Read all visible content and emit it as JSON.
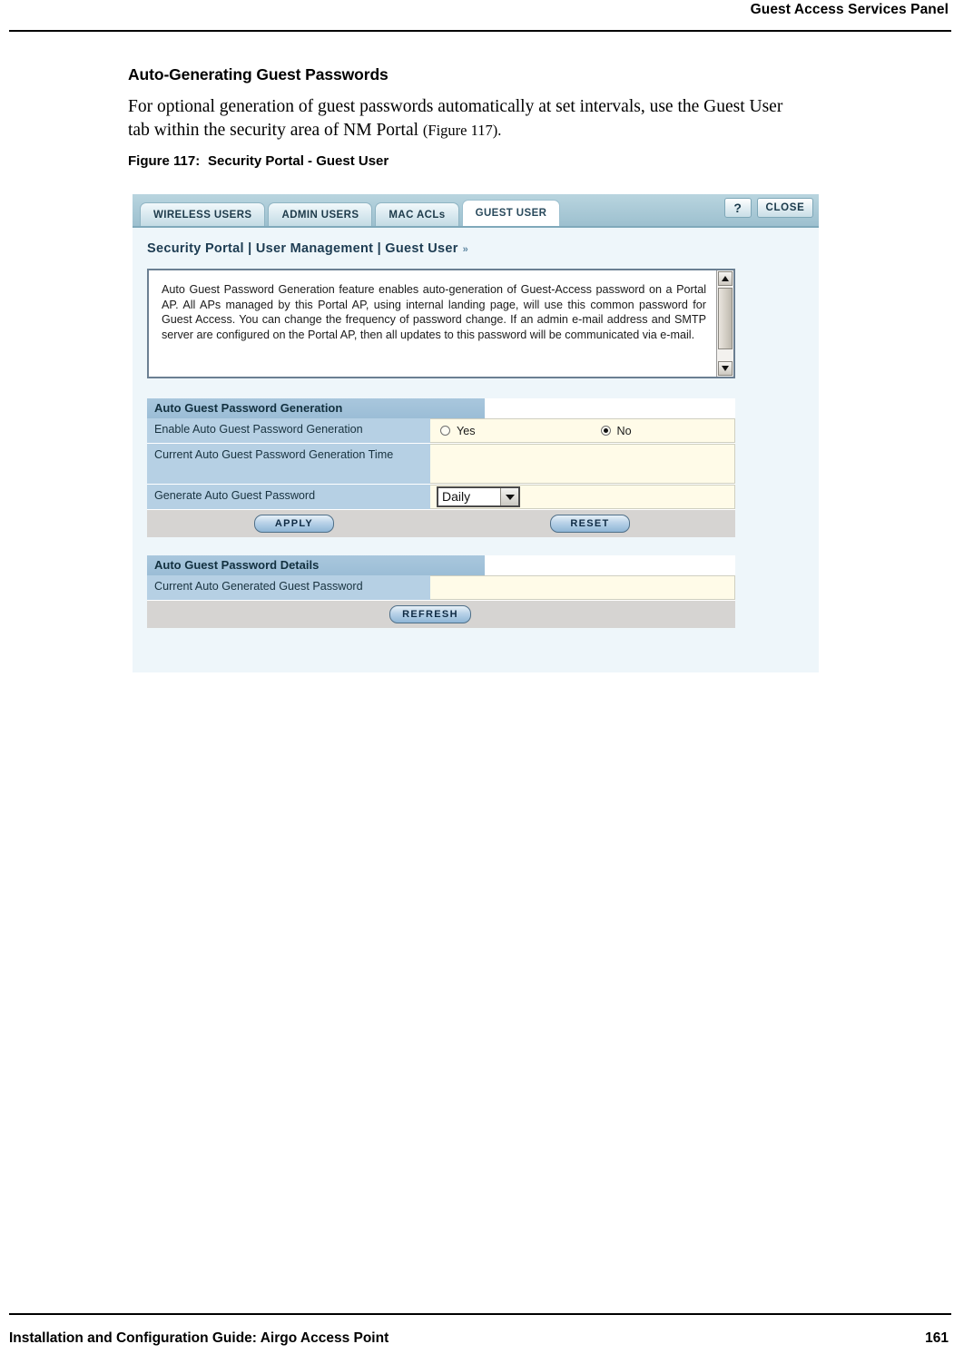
{
  "page": {
    "running_head": "Guest Access Services Panel",
    "footer_left": "Installation and Configuration Guide: Airgo Access Point",
    "footer_page_number": "161"
  },
  "content": {
    "section_heading": "Auto-Generating Guest Passwords",
    "paragraph_main": "For optional generation of guest passwords automatically at set intervals, use the Guest User tab within the security area of NM Portal ",
    "paragraph_figref": "(Figure 117).",
    "figure_caption_number": "Figure 117:",
    "figure_caption_title": "Security Portal - Guest User"
  },
  "screenshot": {
    "tabs": [
      {
        "label": "WIRELESS USERS",
        "active": false
      },
      {
        "label": "ADMIN USERS",
        "active": false
      },
      {
        "label": "MAC ACLs",
        "active": false
      },
      {
        "label": "GUEST USER",
        "active": true
      }
    ],
    "help_button_label": "?",
    "close_button_label": "CLOSE",
    "breadcrumb": "Security Portal | User Management | Guest User",
    "breadcrumb_chevron": "»",
    "description": "Auto Guest Password Generation feature enables auto-generation of Guest-Access password on a Portal AP. All APs managed by this Portal AP, using internal landing page, will use this common password for Guest Access. You can change the frequency of password change. If an admin e-mail address and SMTP server are configured on the Portal AP, then all updates to this password will be communicated via e-mail.",
    "panel_generation": {
      "title": "Auto Guest Password Generation",
      "rows": [
        {
          "label": "Enable Auto Guest Password Generation"
        },
        {
          "label": "Current Auto Guest Password Generation Time",
          "value": ""
        },
        {
          "label": "Generate Auto Guest Password"
        }
      ],
      "enable_options": [
        {
          "label": "Yes",
          "selected": false
        },
        {
          "label": "No",
          "selected": true
        }
      ],
      "frequency_selected": "Daily",
      "apply_label": "APPLY",
      "reset_label": "RESET"
    },
    "panel_details": {
      "title": "Auto Guest Password Details",
      "row_label": "Current Auto Generated Guest Password",
      "row_value": "",
      "refresh_label": "REFRESH"
    }
  }
}
